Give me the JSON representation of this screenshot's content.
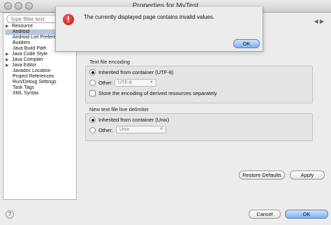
{
  "window": {
    "title": "Properties for MyTest"
  },
  "sidebar": {
    "filter_placeholder": "type filter text",
    "items": [
      {
        "label": "Resource",
        "expandable": true
      },
      {
        "label": "Android",
        "expandable": false,
        "selected": true
      },
      {
        "label": "Android Lint Preferences",
        "expandable": false
      },
      {
        "label": "Builders",
        "expandable": false
      },
      {
        "label": "Java Build Path",
        "expandable": false
      },
      {
        "label": "Java Code Style",
        "expandable": true
      },
      {
        "label": "Java Compiler",
        "expandable": true
      },
      {
        "label": "Java Editor",
        "expandable": true
      },
      {
        "label": "Javadoc Location",
        "expandable": false
      },
      {
        "label": "Project References",
        "expandable": false
      },
      {
        "label": "Run/Debug Settings",
        "expandable": false
      },
      {
        "label": "Task Tags",
        "expandable": false
      },
      {
        "label": "XML Syntax",
        "expandable": false
      }
    ]
  },
  "encoding": {
    "group_label": "Text file encoding",
    "inherited_label": "Inherited from container (UTF-8)",
    "other_label": "Other:",
    "other_value": "UTF-8",
    "store_label": "Store the encoding of derived resources separately"
  },
  "delimiter": {
    "group_label": "New text file line delimiter",
    "inherited_label": "Inherited from container (Unix)",
    "other_label": "Other:",
    "other_value": "Unix"
  },
  "buttons": {
    "restore_defaults": "Restore Defaults",
    "apply": "Apply",
    "cancel": "Cancel",
    "ok": "OK",
    "help": "?"
  },
  "modal": {
    "message": "The currently displayed page contains invalid values.",
    "ok": "OK",
    "icon": "stop-alert-icon"
  }
}
